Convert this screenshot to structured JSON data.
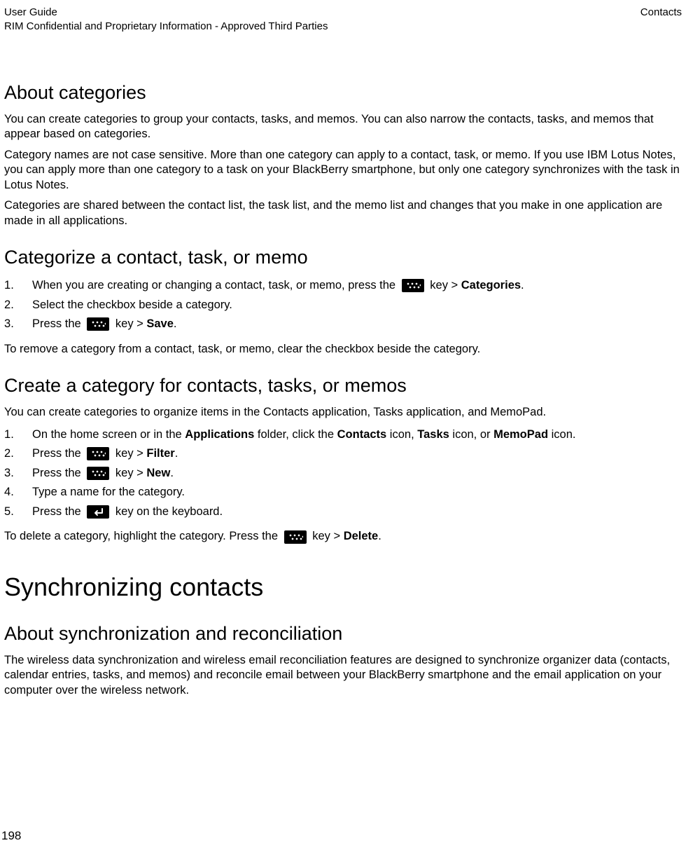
{
  "header": {
    "left_line1": "User Guide",
    "left_line2": "RIM Confidential and Proprietary Information - Approved Third Parties",
    "right": "Contacts"
  },
  "s1": {
    "heading": "About categories",
    "p1": "You can create categories to group your contacts, tasks, and memos. You can also narrow the contacts, tasks, and memos that appear based on categories.",
    "p2": "Category names are not case sensitive. More than one category can apply to a contact, task, or memo. If you use IBM Lotus Notes, you can apply more than one category to a task on your BlackBerry smartphone, but only one category synchronizes with the task in Lotus Notes.",
    "p3": "Categories are shared between the contact list, the task list, and the memo list and changes that you make in one application are made in all applications."
  },
  "s2": {
    "heading": "Categorize a contact, task, or memo",
    "step1_a": "When you are creating or changing a contact, task, or memo, press the ",
    "step1_b": " key > ",
    "step1_bold": "Categories",
    "step1_c": ".",
    "step2": "Select the checkbox beside a category.",
    "step3_a": "Press the ",
    "step3_b": " key > ",
    "step3_bold": "Save",
    "step3_c": ".",
    "after": "To remove a category from a contact, task, or memo, clear the checkbox beside the category."
  },
  "s3": {
    "heading": "Create a category for contacts, tasks, or memos",
    "intro": "You can create categories to organize items in the Contacts application, Tasks application, and MemoPad.",
    "step1_a": "On the home screen or in the ",
    "step1_b1": "Applications",
    "step1_c": " folder, click the ",
    "step1_b2": "Contacts",
    "step1_d": " icon, ",
    "step1_b3": "Tasks",
    "step1_e": " icon, or ",
    "step1_b4": "MemoPad",
    "step1_f": " icon.",
    "step2_a": "Press the ",
    "step2_b": " key > ",
    "step2_bold": "Filter",
    "step2_c": ".",
    "step3_a": "Press the ",
    "step3_b": " key > ",
    "step3_bold": "New",
    "step3_c": ".",
    "step4": "Type a name for the category.",
    "step5_a": "Press the ",
    "step5_b": " key on the keyboard.",
    "after_a": "To delete a category, highlight the category. Press the ",
    "after_b": " key > ",
    "after_bold": "Delete",
    "after_c": "."
  },
  "s4": {
    "major_heading": "Synchronizing contacts",
    "heading": "About synchronization and reconciliation",
    "p1": "The wireless data synchronization and wireless email reconciliation features are designed to synchronize organizer data (contacts, calendar entries, tasks, and memos) and reconcile email between your BlackBerry smartphone and the email application on your computer over the wireless network."
  },
  "page_number": "198"
}
